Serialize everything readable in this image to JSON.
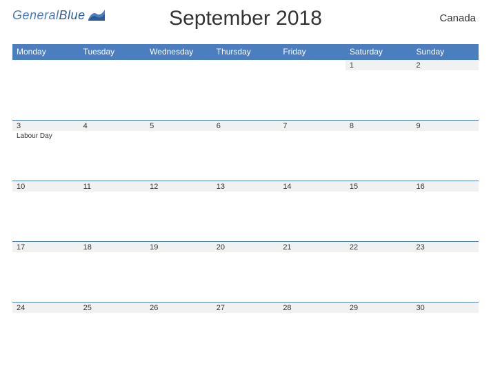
{
  "logo": {
    "text_general": "General",
    "text_blue": "Blue"
  },
  "title": "September 2018",
  "region": "Canada",
  "weekdays": [
    "Monday",
    "Tuesday",
    "Wednesday",
    "Thursday",
    "Friday",
    "Saturday",
    "Sunday"
  ],
  "weeks": [
    {
      "days": [
        {
          "num": "",
          "event": ""
        },
        {
          "num": "",
          "event": ""
        },
        {
          "num": "",
          "event": ""
        },
        {
          "num": "",
          "event": ""
        },
        {
          "num": "",
          "event": ""
        },
        {
          "num": "1",
          "event": ""
        },
        {
          "num": "2",
          "event": ""
        }
      ]
    },
    {
      "days": [
        {
          "num": "3",
          "event": "Labour Day"
        },
        {
          "num": "4",
          "event": ""
        },
        {
          "num": "5",
          "event": ""
        },
        {
          "num": "6",
          "event": ""
        },
        {
          "num": "7",
          "event": ""
        },
        {
          "num": "8",
          "event": ""
        },
        {
          "num": "9",
          "event": ""
        }
      ]
    },
    {
      "days": [
        {
          "num": "10",
          "event": ""
        },
        {
          "num": "11",
          "event": ""
        },
        {
          "num": "12",
          "event": ""
        },
        {
          "num": "13",
          "event": ""
        },
        {
          "num": "14",
          "event": ""
        },
        {
          "num": "15",
          "event": ""
        },
        {
          "num": "16",
          "event": ""
        }
      ]
    },
    {
      "days": [
        {
          "num": "17",
          "event": ""
        },
        {
          "num": "18",
          "event": ""
        },
        {
          "num": "19",
          "event": ""
        },
        {
          "num": "20",
          "event": ""
        },
        {
          "num": "21",
          "event": ""
        },
        {
          "num": "22",
          "event": ""
        },
        {
          "num": "23",
          "event": ""
        }
      ]
    },
    {
      "days": [
        {
          "num": "24",
          "event": ""
        },
        {
          "num": "25",
          "event": ""
        },
        {
          "num": "26",
          "event": ""
        },
        {
          "num": "27",
          "event": ""
        },
        {
          "num": "28",
          "event": ""
        },
        {
          "num": "29",
          "event": ""
        },
        {
          "num": "30",
          "event": ""
        }
      ]
    }
  ]
}
